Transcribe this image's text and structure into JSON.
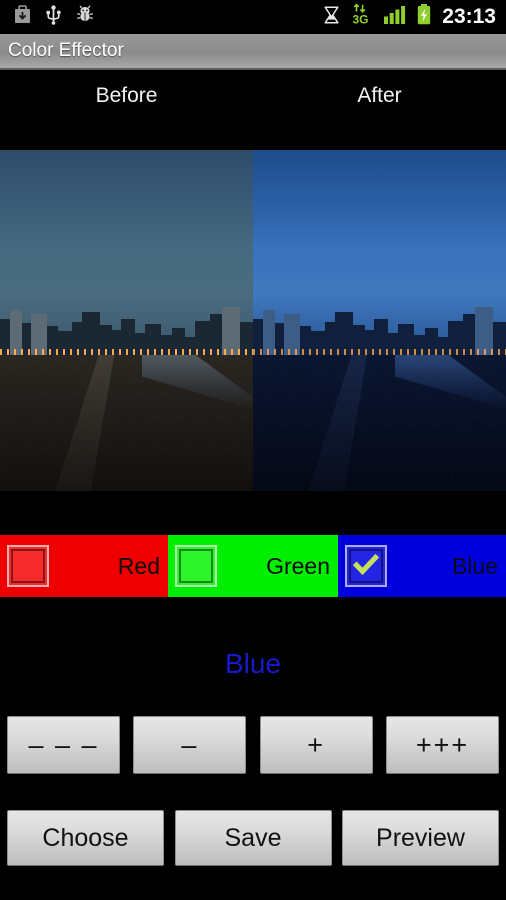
{
  "statusbar": {
    "left_icons": [
      {
        "name": "download-icon"
      },
      {
        "name": "usb-icon"
      },
      {
        "name": "android-debug-icon"
      }
    ],
    "right_icons": [
      {
        "name": "alarm-heart-icon"
      },
      {
        "name": "3g-data-icon",
        "label": "3G"
      },
      {
        "name": "signal-bars-icon"
      },
      {
        "name": "battery-charging-icon"
      }
    ],
    "clock": "23:13"
  },
  "titlebar": {
    "title": "Color Effector"
  },
  "preview": {
    "before_label": "Before",
    "after_label": "After"
  },
  "channels": [
    {
      "key": "red",
      "label": "Red",
      "checked": false,
      "background": "#ee0000",
      "box_color": "#f52b2b"
    },
    {
      "key": "green",
      "label": "Green",
      "checked": false,
      "background": "#00ee00",
      "box_color": "#2cf52c"
    },
    {
      "key": "blue",
      "label": "Blue",
      "checked": true,
      "background": "#0000dd",
      "box_color": "#2424e4"
    }
  ],
  "selected_channel": {
    "label": "Blue",
    "color": "#1919cc"
  },
  "adjust_buttons": [
    {
      "key": "minus-large",
      "label": "– – –"
    },
    {
      "key": "minus-small",
      "label": "–"
    },
    {
      "key": "plus-small",
      "label": "+"
    },
    {
      "key": "plus-large",
      "label": "+++"
    }
  ],
  "action_buttons": [
    {
      "key": "choose",
      "label": "Choose"
    },
    {
      "key": "save",
      "label": "Save"
    },
    {
      "key": "preview",
      "label": "Preview"
    }
  ]
}
